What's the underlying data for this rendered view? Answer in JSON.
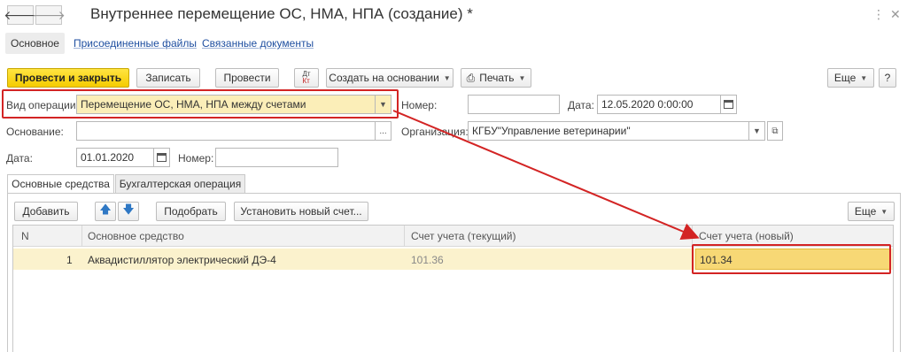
{
  "window": {
    "title": "Внутреннее перемещение ОС, НМА, НПА (создание) *",
    "back_icon": "arrow-left-icon",
    "forward_icon": "arrow-right-icon"
  },
  "subnav": {
    "main": "Основное",
    "files": "Присоединенные файлы",
    "related": "Связанные документы"
  },
  "toolbar": {
    "post_close": "Провести и закрыть",
    "save": "Записать",
    "post": "Провести",
    "dtkt_top": "Дт",
    "dtkt_bottom": "Кт",
    "create_based": "Создать на основании",
    "print": "Печать",
    "more": "Еще"
  },
  "form": {
    "operation_label": "Вид операции:",
    "operation_value": "Перемещение ОС, НМА, НПА между счетами",
    "number_label": "Номер:",
    "number_value": "",
    "date_label": "Дата:",
    "date_value": "12.05.2020  0:00:00",
    "basis_label": "Основание:",
    "basis_value": "",
    "basis_dots": "...",
    "org_label": "Организация:",
    "org_value": "КГБУ\"Управление ветеринарии\"",
    "date2_label": "Дата:",
    "date2_value": "01.01.2020",
    "number2_label": "Номер:",
    "number2_value": ""
  },
  "tabs": {
    "assets": "Основные средства",
    "accounting": "Бухгалтерская операция"
  },
  "table_toolbar": {
    "add": "Добавить",
    "pick": "Подобрать",
    "set_account": "Установить новый счет...",
    "more": "Еще"
  },
  "table": {
    "columns": [
      "N",
      "Основное средство",
      "Счет учета (текущий)",
      "Счет учета (новый)"
    ],
    "rows": [
      {
        "n": "1",
        "asset": "Аквадистиллятор электрический ДЭ-4",
        "current": "101.36",
        "new": "101.34"
      }
    ]
  },
  "colors": {
    "highlight": "#d32424",
    "primary_button": "#f5cc00",
    "row_selected": "#fbf2cd"
  }
}
